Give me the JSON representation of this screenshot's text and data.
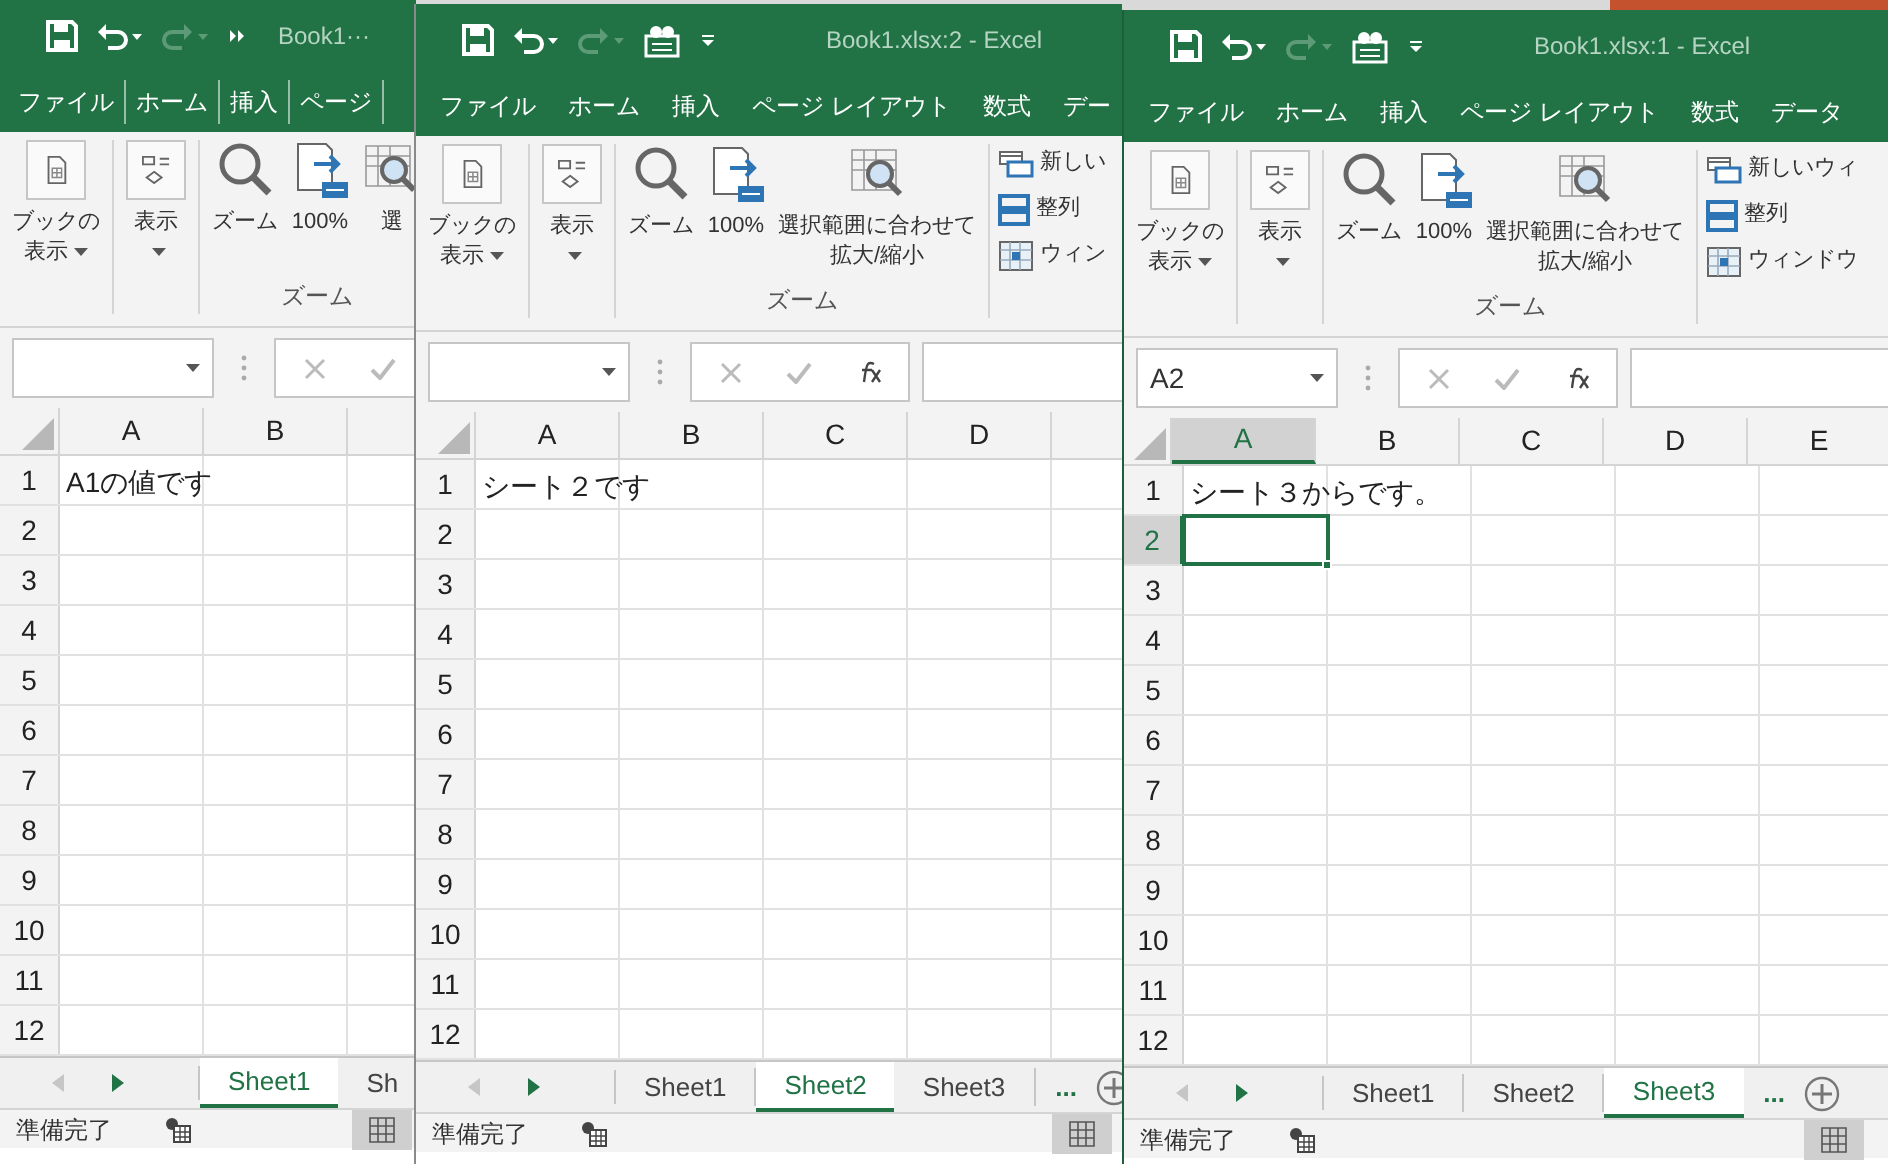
{
  "windows": [
    {
      "title": "Book1···",
      "compact": true,
      "tabs": [
        "ファイル",
        "ホーム",
        "挿入",
        "ページ"
      ],
      "ribbon": {
        "groups": [
          {
            "buttons": [
              {
                "kind": "book",
                "lines": [
                  "ブックの",
                  "表示"
                ],
                "dropdown": true
              }
            ]
          },
          {
            "buttons": [
              {
                "kind": "display",
                "lines": [
                  "表示"
                ],
                "dropdown": true
              }
            ]
          },
          {
            "label": "ズーム",
            "buttons": [
              {
                "kind": "zoom",
                "lines": [
                  "ズーム"
                ],
                "dropdown": false
              },
              {
                "kind": "hundred",
                "lines": [
                  "100%"
                ],
                "dropdown": false
              },
              {
                "kind": "fit",
                "lines": [
                  "選"
                ],
                "dropdown": false
              }
            ]
          }
        ]
      },
      "columns": [
        {
          "label": "A",
          "selected": false
        },
        {
          "label": "B",
          "selected": false
        }
      ],
      "rows": [
        {
          "label": "1",
          "selected": false,
          "value": "A1の値です"
        },
        {
          "label": "2",
          "selected": false
        },
        {
          "label": "3",
          "selected": false
        },
        {
          "label": "4",
          "selected": false
        },
        {
          "label": "5",
          "selected": false
        },
        {
          "label": "6",
          "selected": false
        },
        {
          "label": "7",
          "selected": false
        },
        {
          "label": "8",
          "selected": false
        },
        {
          "label": "9",
          "selected": false
        },
        {
          "label": "10",
          "selected": false
        },
        {
          "label": "11",
          "selected": false
        },
        {
          "label": "12",
          "selected": false
        }
      ],
      "sheets": [
        {
          "label": "Sheet1",
          "selected": true
        },
        {
          "label": "Sh",
          "selected": false
        }
      ],
      "status": "準備完了"
    },
    {
      "title": "Book1.xlsx:2 - Excel",
      "compact": false,
      "tabs": [
        "ファイル",
        "ホーム",
        "挿入",
        "ページ レイアウト",
        "数式",
        "デー"
      ],
      "ribbon": {
        "groups": [
          {
            "buttons": [
              {
                "kind": "book",
                "lines": [
                  "ブックの",
                  "表示"
                ],
                "dropdown": true
              }
            ]
          },
          {
            "buttons": [
              {
                "kind": "display",
                "lines": [
                  "表示"
                ],
                "dropdown": true
              }
            ]
          },
          {
            "label": "ズーム",
            "buttons": [
              {
                "kind": "zoom",
                "lines": [
                  "ズーム"
                ],
                "dropdown": false
              },
              {
                "kind": "hundred",
                "lines": [
                  "100%"
                ],
                "dropdown": false
              },
              {
                "kind": "fit",
                "lines": [
                  "選択範囲に合わせて",
                  "拡大/縮小"
                ],
                "dropdown": false
              }
            ]
          }
        ],
        "side_items": [
          {
            "kind": "new",
            "label": "新しい"
          },
          {
            "kind": "arrange",
            "label": "整列"
          },
          {
            "kind": "freeze",
            "label": "ウィン"
          }
        ]
      },
      "columns": [
        {
          "label": "A",
          "selected": false
        },
        {
          "label": "B",
          "selected": false
        },
        {
          "label": "C",
          "selected": false
        },
        {
          "label": "D",
          "selected": false
        }
      ],
      "rows": [
        {
          "label": "1",
          "selected": false,
          "value": "シート２です"
        },
        {
          "label": "2",
          "selected": false
        },
        {
          "label": "3",
          "selected": false
        },
        {
          "label": "4",
          "selected": false
        },
        {
          "label": "5",
          "selected": false
        },
        {
          "label": "6",
          "selected": false
        },
        {
          "label": "7",
          "selected": false
        },
        {
          "label": "8",
          "selected": false
        },
        {
          "label": "9",
          "selected": false
        },
        {
          "label": "10",
          "selected": false
        },
        {
          "label": "11",
          "selected": false
        },
        {
          "label": "12",
          "selected": false
        }
      ],
      "sheets": [
        {
          "label": "Sheet1",
          "selected": false
        },
        {
          "label": "Sheet2",
          "selected": true
        },
        {
          "label": "Sheet3",
          "selected": false
        }
      ],
      "more": "...",
      "status": "準備完了"
    },
    {
      "title": "Book1.xlsx:1 - Excel",
      "compact": false,
      "tabs": [
        "ファイル",
        "ホーム",
        "挿入",
        "ページ レイアウト",
        "数式",
        "データ"
      ],
      "ribbon": {
        "groups": [
          {
            "buttons": [
              {
                "kind": "book",
                "lines": [
                  "ブックの",
                  "表示"
                ],
                "dropdown": true
              }
            ]
          },
          {
            "buttons": [
              {
                "kind": "display",
                "lines": [
                  "表示"
                ],
                "dropdown": true
              }
            ]
          },
          {
            "label": "ズーム",
            "buttons": [
              {
                "kind": "zoom",
                "lines": [
                  "ズーム"
                ],
                "dropdown": false
              },
              {
                "kind": "hundred",
                "lines": [
                  "100%"
                ],
                "dropdown": false
              },
              {
                "kind": "fit",
                "lines": [
                  "選択範囲に合わせて",
                  "拡大/縮小"
                ],
                "dropdown": false
              }
            ]
          }
        ],
        "side_items": [
          {
            "kind": "new",
            "label": "新しいウィ"
          },
          {
            "kind": "arrange",
            "label": "整列"
          },
          {
            "kind": "freeze",
            "label": "ウィンドウ"
          }
        ]
      },
      "name_box": "A2",
      "columns": [
        {
          "label": "A",
          "selected": true
        },
        {
          "label": "B",
          "selected": false
        },
        {
          "label": "C",
          "selected": false
        },
        {
          "label": "D",
          "selected": false
        },
        {
          "label": "E",
          "selected": false
        }
      ],
      "rows": [
        {
          "label": "1",
          "selected": false,
          "value": "シート３からです。"
        },
        {
          "label": "2",
          "selected": true
        },
        {
          "label": "3",
          "selected": false
        },
        {
          "label": "4",
          "selected": false
        },
        {
          "label": "5",
          "selected": false
        },
        {
          "label": "6",
          "selected": false
        },
        {
          "label": "7",
          "selected": false
        },
        {
          "label": "8",
          "selected": false
        },
        {
          "label": "9",
          "selected": false
        },
        {
          "label": "10",
          "selected": false
        },
        {
          "label": "11",
          "selected": false
        },
        {
          "label": "12",
          "selected": false
        }
      ],
      "sheets": [
        {
          "label": "Sheet1",
          "selected": false
        },
        {
          "label": "Sheet2",
          "selected": false
        },
        {
          "label": "Sheet3",
          "selected": true
        }
      ],
      "more": "...",
      "status": "準備完了"
    }
  ]
}
